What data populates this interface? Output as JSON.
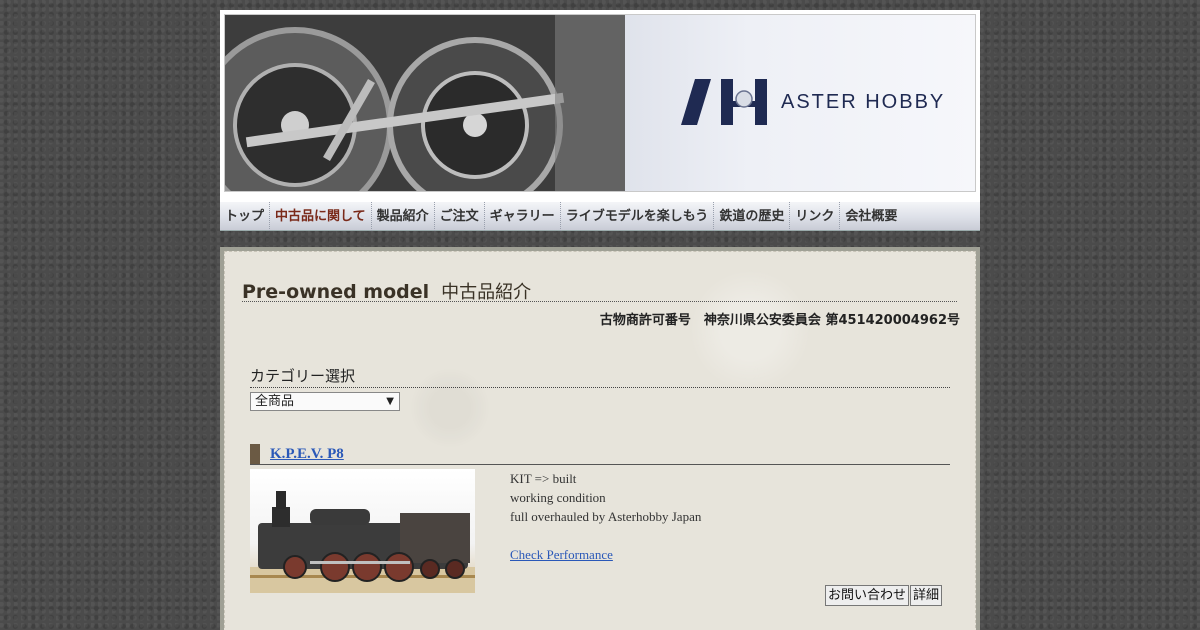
{
  "header": {
    "brand": "ASTER HOBBY"
  },
  "nav": {
    "items": [
      {
        "label": "トップ"
      },
      {
        "label": "中古品に関して"
      },
      {
        "label": "製品紹介"
      },
      {
        "label": "ご注文"
      },
      {
        "label": "ギャラリー"
      },
      {
        "label": "ライブモデルを楽しもう"
      },
      {
        "label": "鉄道の歴史"
      },
      {
        "label": "リンク"
      },
      {
        "label": "会社概要"
      }
    ],
    "active_index": 1
  },
  "page": {
    "heading_en": "Pre-owned model",
    "heading_ja": "中古品紹介",
    "license": "古物商許可番号　神奈川県公安委員会 第451420004962号"
  },
  "category": {
    "title": "カテゴリー選択",
    "selected": "全商品"
  },
  "product": {
    "title": "K.P.E.V. P8",
    "lines": [
      "KIT => built",
      "working condition",
      "full overhauled by Asterhobby Japan"
    ],
    "link": "Check Performance",
    "inquiry_button": "お問い合わせ",
    "detail_button": "詳細"
  },
  "colors": {
    "background": "#4b4b4b",
    "panel": "#e7e4db",
    "link": "#2a58b8",
    "accent_bar": "#6b5a44"
  }
}
